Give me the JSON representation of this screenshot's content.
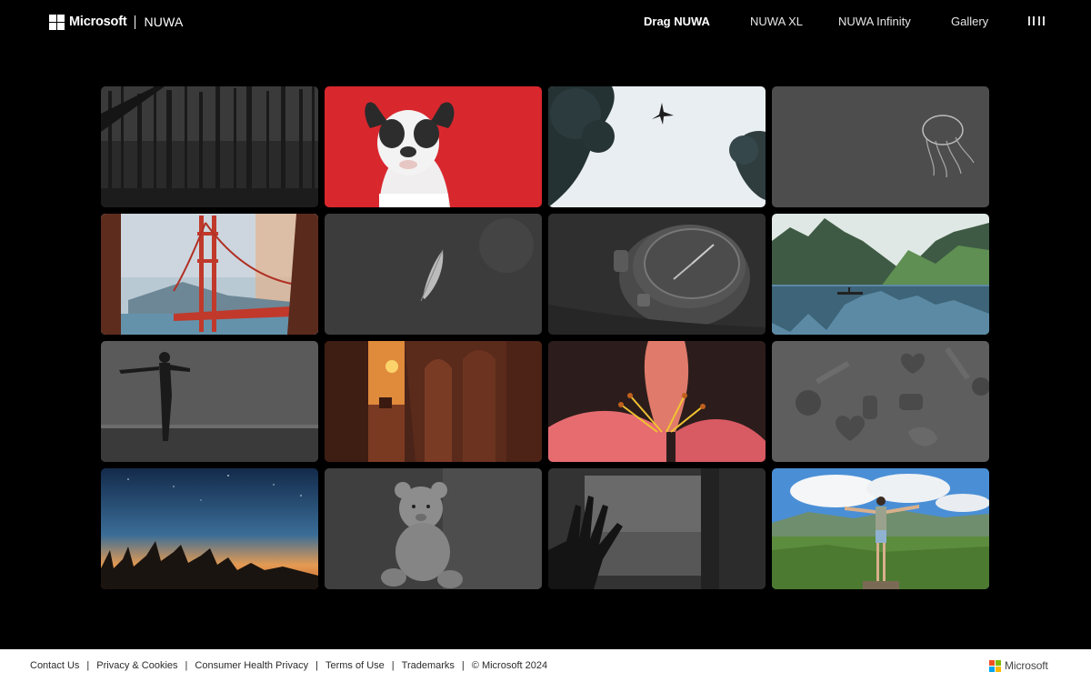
{
  "header": {
    "brand_company": "Microsoft",
    "brand_product": "NUWA",
    "nav": [
      {
        "label": "Drag NUWA",
        "active": true
      },
      {
        "label": "NUWA XL",
        "active": false
      },
      {
        "label": "NUWA Infinity",
        "active": false
      },
      {
        "label": "Gallery",
        "active": false
      }
    ],
    "menu_icon": "hamburger-lines-icon"
  },
  "logo_colors": [
    "#f25022",
    "#7fba00",
    "#00a4ef",
    "#ffb900"
  ],
  "gallery": {
    "tiles": [
      {
        "name": "dark-forest"
      },
      {
        "name": "french-bulldog-red"
      },
      {
        "name": "airplane-sky-trees"
      },
      {
        "name": "jellyfish-sketch"
      },
      {
        "name": "golden-gate-bridge"
      },
      {
        "name": "feather"
      },
      {
        "name": "wristwatch"
      },
      {
        "name": "karst-lake-boat"
      },
      {
        "name": "silhouette-arms-open"
      },
      {
        "name": "sunset-archway"
      },
      {
        "name": "lily-flower"
      },
      {
        "name": "candy-pieces"
      },
      {
        "name": "starry-sunset-trees"
      },
      {
        "name": "teddy-bear"
      },
      {
        "name": "hand-window"
      },
      {
        "name": "man-arms-mountains"
      }
    ]
  },
  "footer": {
    "links": [
      "Contact Us",
      "Privacy & Cookies",
      "Consumer Health Privacy",
      "Terms of Use",
      "Trademarks"
    ],
    "copyright": "© Microsoft 2024",
    "brand": "Microsoft"
  }
}
